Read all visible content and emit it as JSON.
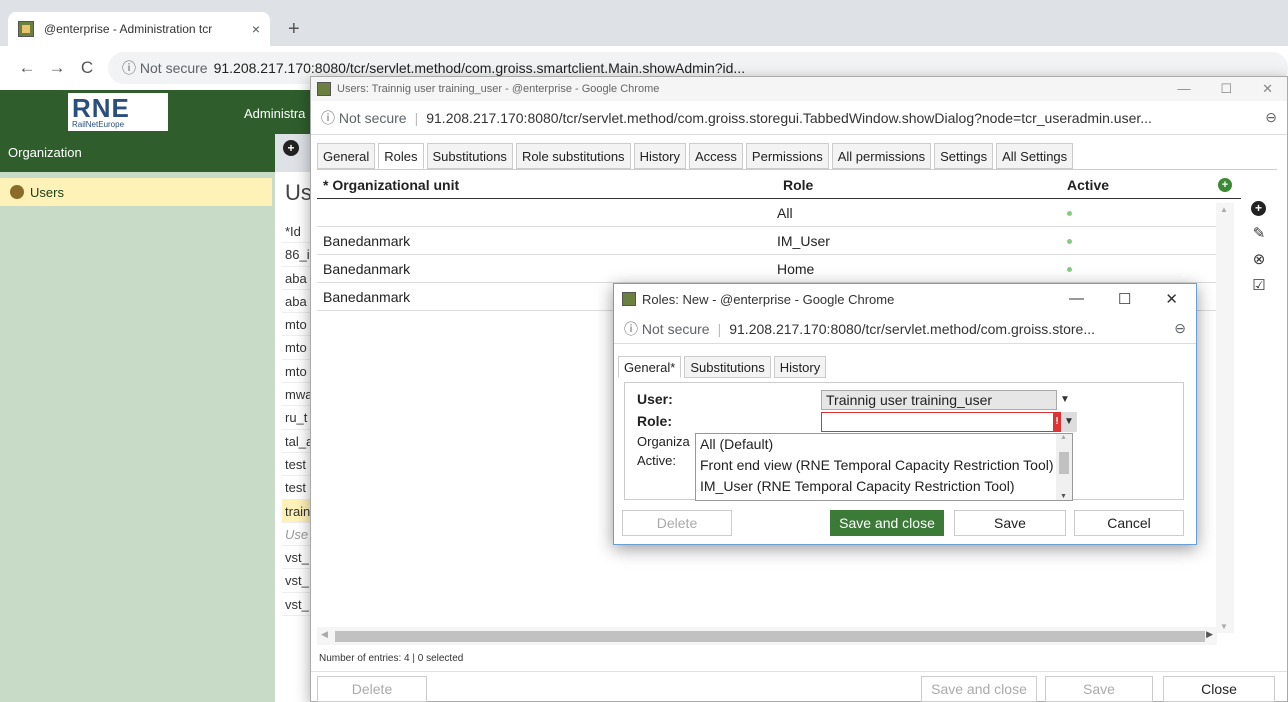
{
  "browser": {
    "tab_title": "@enterprise - Administration tcr",
    "tab_close": "×",
    "new_tab": "+",
    "not_secure": "ⓘ Not secure",
    "url": "91.208.217.170:8080/tcr/servlet.method/com.groiss.smartclient.Main.showAdmin?id...",
    "back": "←",
    "forward": "→",
    "reload": "C"
  },
  "app": {
    "logo_text": "RNE",
    "logo_sub": "RailNetEurope",
    "admin_label": "Administra",
    "org_label": "Organization",
    "sidebar_users": "Users",
    "page_title": "Us",
    "id_header": "*Id",
    "back_rows": [
      "86_i",
      "aba",
      "aba",
      "mto",
      "mto",
      "mto",
      "mwa",
      "ru_t",
      "tal_a",
      "test",
      "test",
      "train",
      "Use",
      "vst_",
      "vst_",
      "vst_"
    ]
  },
  "users_window": {
    "title": "Users: Trainnig user training_user - @enterprise - Google Chrome",
    "not_secure": "ⓘ Not secure",
    "url": "91.208.217.170:8080/tcr/servlet.method/com.groiss.storegui.TabbedWindow.showDialog?node=tcr_useradmin.user...",
    "zoom": "⊖",
    "ctrl_min": "—",
    "ctrl_max": "☐",
    "ctrl_close": "✕",
    "tabs": [
      "General",
      "Roles",
      "Substitutions",
      "Role substitutions",
      "History",
      "Access",
      "Permissions",
      "All permissions",
      "Settings",
      "All Settings"
    ],
    "columns": {
      "org": "Organizational unit",
      "role": "Role",
      "active": "Active"
    },
    "rows": [
      {
        "org": "",
        "role": "All"
      },
      {
        "org": "Banedanmark",
        "role": "IM_User"
      },
      {
        "org": "Banedanmark",
        "role": "Home"
      },
      {
        "org": "Banedanmark",
        "role": ""
      }
    ],
    "entries": "Number of entries: 4 | 0 selected",
    "buttons": {
      "delete": "Delete",
      "save_close": "Save and close",
      "save": "Save",
      "close": "Close"
    }
  },
  "roles_dialog": {
    "title": "Roles: New - @enterprise - Google Chrome",
    "not_secure": "ⓘ Not secure",
    "url": "91.208.217.170:8080/tcr/servlet.method/com.groiss.store...",
    "zoom": "⊖",
    "ctrl_min": "—",
    "ctrl_max": "☐",
    "ctrl_close": "✕",
    "tabs": [
      "General*",
      "Substitutions",
      "History"
    ],
    "labels": {
      "user": "User:",
      "role": "Role:",
      "org": "Organiza",
      "active": "Active:"
    },
    "user_value": "Trainnig user training_user",
    "role_error": "!",
    "options": [
      "All (Default)",
      "Front end view (RNE Temporal Capacity Restriction Tool)",
      "IM_User (RNE Temporal Capacity Restriction Tool)"
    ],
    "buttons": {
      "delete": "Delete",
      "save_close": "Save and close",
      "save": "Save",
      "cancel": "Cancel"
    }
  }
}
